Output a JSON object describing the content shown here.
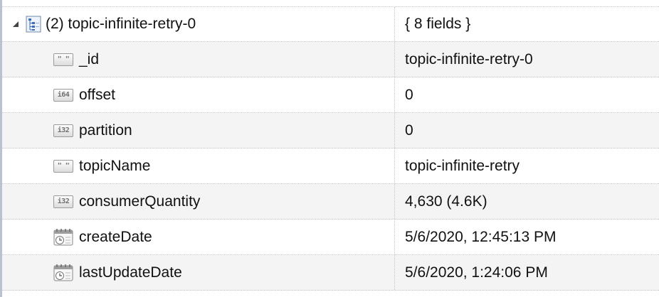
{
  "document": {
    "label": "(2) topic-infinite-retry-0",
    "summary": "{ 8 fields }",
    "icon": "document-tree-icon"
  },
  "fields": [
    {
      "key": "_id",
      "value": "topic-infinite-retry-0",
      "type_icon": "string-type-icon",
      "badge": "\" \""
    },
    {
      "key": "offset",
      "value": "0",
      "type_icon": "int64-type-icon",
      "badge": "i64"
    },
    {
      "key": "partition",
      "value": "0",
      "type_icon": "int32-type-icon",
      "badge": "i32"
    },
    {
      "key": "topicName",
      "value": "topic-infinite-retry",
      "type_icon": "string-type-icon",
      "badge": "\" \""
    },
    {
      "key": "consumerQuantity",
      "value": "4,630 (4.6K)",
      "type_icon": "int32-type-icon",
      "badge": "i32"
    },
    {
      "key": "createDate",
      "value": "5/6/2020, 12:45:13 PM",
      "type_icon": "date-type-icon",
      "badge": ""
    },
    {
      "key": "lastUpdateDate",
      "value": "5/6/2020, 1:24:06 PM",
      "type_icon": "date-type-icon",
      "badge": ""
    }
  ]
}
